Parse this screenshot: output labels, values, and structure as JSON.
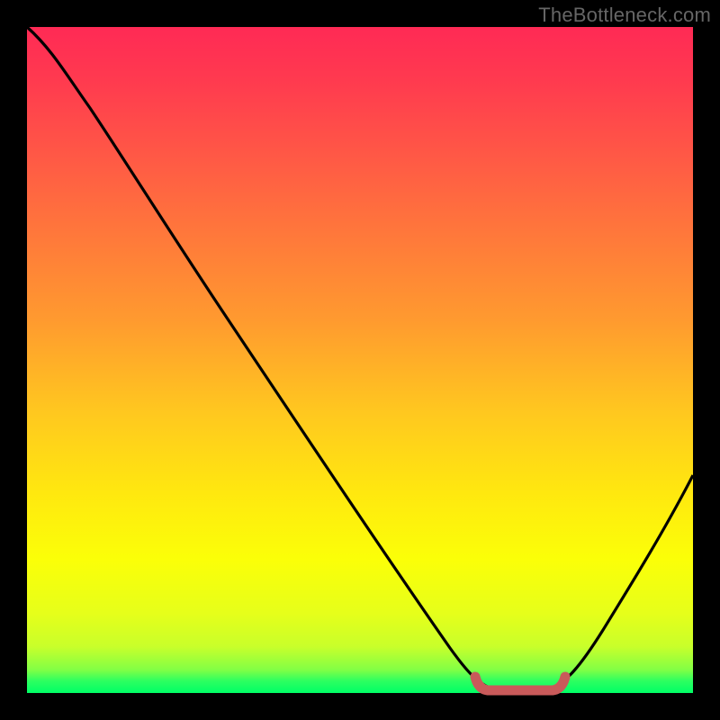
{
  "watermark": "TheBottleneck.com",
  "colors": {
    "frame": "#000000",
    "grad_top": "#ff2a55",
    "grad_mid": "#ffe80f",
    "grad_bottom": "#00ff66",
    "curve": "#000000",
    "zone": "#c95a5a"
  },
  "chart_data": {
    "type": "line",
    "title": "",
    "xlabel": "",
    "ylabel": "",
    "xlim": [
      0,
      100
    ],
    "ylim": [
      0,
      100
    ],
    "grid": false,
    "legend": false,
    "x": [
      0,
      5,
      10,
      15,
      20,
      25,
      30,
      35,
      40,
      45,
      50,
      55,
      60,
      65,
      67,
      70,
      74,
      78,
      80,
      85,
      90,
      95,
      100
    ],
    "values": [
      100,
      96,
      91,
      84,
      76,
      68,
      60,
      52,
      44,
      36,
      28,
      20,
      13,
      6,
      3,
      1,
      0,
      0,
      1,
      6,
      14,
      23,
      33
    ],
    "optimal_zone": {
      "x_start": 67,
      "x_end": 80,
      "y": 0
    }
  }
}
